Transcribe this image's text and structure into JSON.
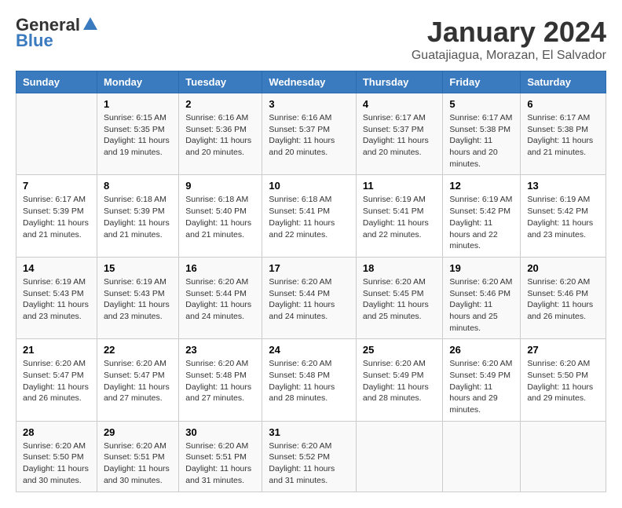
{
  "logo": {
    "general": "General",
    "blue": "Blue"
  },
  "title": "January 2024",
  "subtitle": "Guatajiagua, Morazan, El Salvador",
  "days_of_week": [
    "Sunday",
    "Monday",
    "Tuesday",
    "Wednesday",
    "Thursday",
    "Friday",
    "Saturday"
  ],
  "weeks": [
    [
      {
        "num": "",
        "sunrise": "",
        "sunset": "",
        "daylight": ""
      },
      {
        "num": "1",
        "sunrise": "Sunrise: 6:15 AM",
        "sunset": "Sunset: 5:35 PM",
        "daylight": "Daylight: 11 hours and 19 minutes."
      },
      {
        "num": "2",
        "sunrise": "Sunrise: 6:16 AM",
        "sunset": "Sunset: 5:36 PM",
        "daylight": "Daylight: 11 hours and 20 minutes."
      },
      {
        "num": "3",
        "sunrise": "Sunrise: 6:16 AM",
        "sunset": "Sunset: 5:37 PM",
        "daylight": "Daylight: 11 hours and 20 minutes."
      },
      {
        "num": "4",
        "sunrise": "Sunrise: 6:17 AM",
        "sunset": "Sunset: 5:37 PM",
        "daylight": "Daylight: 11 hours and 20 minutes."
      },
      {
        "num": "5",
        "sunrise": "Sunrise: 6:17 AM",
        "sunset": "Sunset: 5:38 PM",
        "daylight": "Daylight: 11 hours and 20 minutes."
      },
      {
        "num": "6",
        "sunrise": "Sunrise: 6:17 AM",
        "sunset": "Sunset: 5:38 PM",
        "daylight": "Daylight: 11 hours and 21 minutes."
      }
    ],
    [
      {
        "num": "7",
        "sunrise": "Sunrise: 6:17 AM",
        "sunset": "Sunset: 5:39 PM",
        "daylight": "Daylight: 11 hours and 21 minutes."
      },
      {
        "num": "8",
        "sunrise": "Sunrise: 6:18 AM",
        "sunset": "Sunset: 5:39 PM",
        "daylight": "Daylight: 11 hours and 21 minutes."
      },
      {
        "num": "9",
        "sunrise": "Sunrise: 6:18 AM",
        "sunset": "Sunset: 5:40 PM",
        "daylight": "Daylight: 11 hours and 21 minutes."
      },
      {
        "num": "10",
        "sunrise": "Sunrise: 6:18 AM",
        "sunset": "Sunset: 5:41 PM",
        "daylight": "Daylight: 11 hours and 22 minutes."
      },
      {
        "num": "11",
        "sunrise": "Sunrise: 6:19 AM",
        "sunset": "Sunset: 5:41 PM",
        "daylight": "Daylight: 11 hours and 22 minutes."
      },
      {
        "num": "12",
        "sunrise": "Sunrise: 6:19 AM",
        "sunset": "Sunset: 5:42 PM",
        "daylight": "Daylight: 11 hours and 22 minutes."
      },
      {
        "num": "13",
        "sunrise": "Sunrise: 6:19 AM",
        "sunset": "Sunset: 5:42 PM",
        "daylight": "Daylight: 11 hours and 23 minutes."
      }
    ],
    [
      {
        "num": "14",
        "sunrise": "Sunrise: 6:19 AM",
        "sunset": "Sunset: 5:43 PM",
        "daylight": "Daylight: 11 hours and 23 minutes."
      },
      {
        "num": "15",
        "sunrise": "Sunrise: 6:19 AM",
        "sunset": "Sunset: 5:43 PM",
        "daylight": "Daylight: 11 hours and 23 minutes."
      },
      {
        "num": "16",
        "sunrise": "Sunrise: 6:20 AM",
        "sunset": "Sunset: 5:44 PM",
        "daylight": "Daylight: 11 hours and 24 minutes."
      },
      {
        "num": "17",
        "sunrise": "Sunrise: 6:20 AM",
        "sunset": "Sunset: 5:44 PM",
        "daylight": "Daylight: 11 hours and 24 minutes."
      },
      {
        "num": "18",
        "sunrise": "Sunrise: 6:20 AM",
        "sunset": "Sunset: 5:45 PM",
        "daylight": "Daylight: 11 hours and 25 minutes."
      },
      {
        "num": "19",
        "sunrise": "Sunrise: 6:20 AM",
        "sunset": "Sunset: 5:46 PM",
        "daylight": "Daylight: 11 hours and 25 minutes."
      },
      {
        "num": "20",
        "sunrise": "Sunrise: 6:20 AM",
        "sunset": "Sunset: 5:46 PM",
        "daylight": "Daylight: 11 hours and 26 minutes."
      }
    ],
    [
      {
        "num": "21",
        "sunrise": "Sunrise: 6:20 AM",
        "sunset": "Sunset: 5:47 PM",
        "daylight": "Daylight: 11 hours and 26 minutes."
      },
      {
        "num": "22",
        "sunrise": "Sunrise: 6:20 AM",
        "sunset": "Sunset: 5:47 PM",
        "daylight": "Daylight: 11 hours and 27 minutes."
      },
      {
        "num": "23",
        "sunrise": "Sunrise: 6:20 AM",
        "sunset": "Sunset: 5:48 PM",
        "daylight": "Daylight: 11 hours and 27 minutes."
      },
      {
        "num": "24",
        "sunrise": "Sunrise: 6:20 AM",
        "sunset": "Sunset: 5:48 PM",
        "daylight": "Daylight: 11 hours and 28 minutes."
      },
      {
        "num": "25",
        "sunrise": "Sunrise: 6:20 AM",
        "sunset": "Sunset: 5:49 PM",
        "daylight": "Daylight: 11 hours and 28 minutes."
      },
      {
        "num": "26",
        "sunrise": "Sunrise: 6:20 AM",
        "sunset": "Sunset: 5:49 PM",
        "daylight": "Daylight: 11 hours and 29 minutes."
      },
      {
        "num": "27",
        "sunrise": "Sunrise: 6:20 AM",
        "sunset": "Sunset: 5:50 PM",
        "daylight": "Daylight: 11 hours and 29 minutes."
      }
    ],
    [
      {
        "num": "28",
        "sunrise": "Sunrise: 6:20 AM",
        "sunset": "Sunset: 5:50 PM",
        "daylight": "Daylight: 11 hours and 30 minutes."
      },
      {
        "num": "29",
        "sunrise": "Sunrise: 6:20 AM",
        "sunset": "Sunset: 5:51 PM",
        "daylight": "Daylight: 11 hours and 30 minutes."
      },
      {
        "num": "30",
        "sunrise": "Sunrise: 6:20 AM",
        "sunset": "Sunset: 5:51 PM",
        "daylight": "Daylight: 11 hours and 31 minutes."
      },
      {
        "num": "31",
        "sunrise": "Sunrise: 6:20 AM",
        "sunset": "Sunset: 5:52 PM",
        "daylight": "Daylight: 11 hours and 31 minutes."
      },
      {
        "num": "",
        "sunrise": "",
        "sunset": "",
        "daylight": ""
      },
      {
        "num": "",
        "sunrise": "",
        "sunset": "",
        "daylight": ""
      },
      {
        "num": "",
        "sunrise": "",
        "sunset": "",
        "daylight": ""
      }
    ]
  ]
}
